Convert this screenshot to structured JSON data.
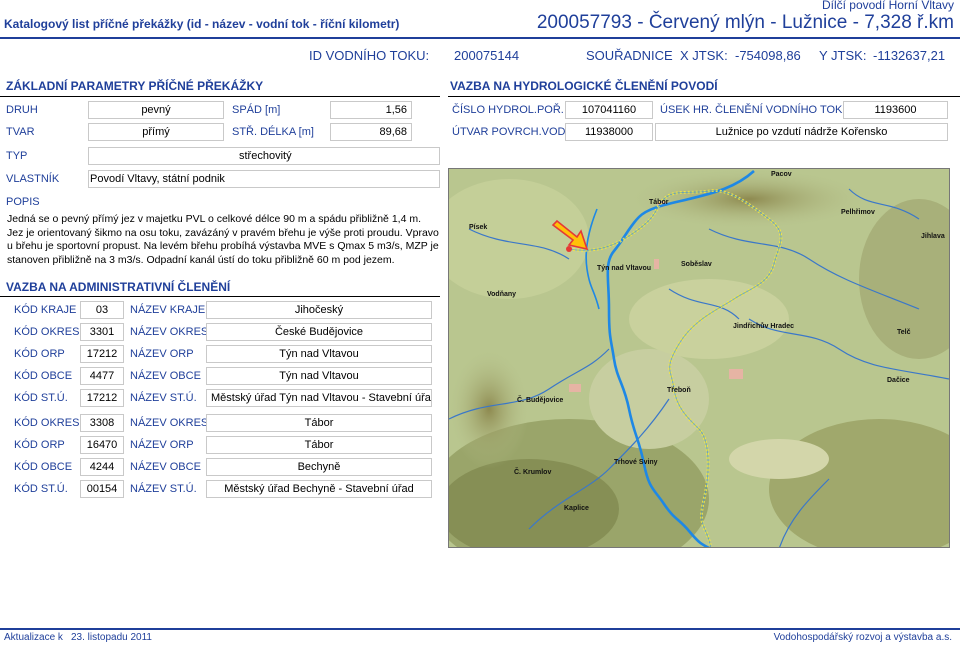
{
  "header": {
    "left_title": "Katalogový list příčné překážky (id - název - vodní tok - říční kilometr)",
    "region": "Dílčí povodí Horní Vltavy",
    "object_title": "200057793 - Červený mlýn - Lužnice - 7,328 ř.km",
    "id_label": "ID VODNÍHO TOKU:",
    "id_value": "200075144",
    "coords_label": "SOUŘADNICE",
    "x_label": "X JTSK:",
    "x_value": "-754098,86",
    "y_label": "Y JTSK:",
    "y_value": "-1132637,21"
  },
  "basic": {
    "title": "ZÁKLADNÍ PARAMETRY PŘÍČNÉ PŘEKÁŽKY",
    "druh_label": "DRUH",
    "druh_value": "pevný",
    "spad_label": "SPÁD [m]",
    "spad_value": "1,56",
    "tvar_label": "TVAR",
    "tvar_value": "přímý",
    "delka_label": "STŘ. DÉLKA [m]",
    "delka_value": "89,68",
    "typ_label": "TYP",
    "typ_value": "střechovitý",
    "vlastnik_label": "VLASTNÍK",
    "vlastnik_value": "Povodí Vltavy, státní podnik",
    "popis_label": "POPIS",
    "popis_text": "Jedná se o pevný přímý jez v majetku PVL o celkové délce 90 m a spádu přibližně 1,4 m. Jez je orientovaný šikmo na osu toku, zavázáný v pravém břehu je výše proti proudu. Vpravo u břehu je sportovní propust. Na levém břehu probíhá výstavba MVE s Qmax 5 m3/s, MZP je stanoven přibližně na 3 m3/s. Odpadní kanál ústí do toku přibližně 60 m pod jezem."
  },
  "hydro": {
    "title": "VAZBA NA HYDROLOGICKÉ ČLENĚNÍ POVODÍ",
    "cislo_label": "ČÍSLO HYDROL.POŘ.",
    "cislo_value": "107041160",
    "usek_label": "ÚSEK HR. ČLENĚNÍ VODNÍHO TOKU",
    "usek_value": "1193600",
    "utvar_label": "ÚTVAR POVRCH.VOD",
    "utvar_value": "11938000",
    "utvar_name": "Lužnice po vzdutí nádrže Kořensko"
  },
  "admin": {
    "title": "VAZBA NA ADMINISTRATIVNÍ ČLENĚNÍ",
    "rows": [
      {
        "code_label": "KÓD KRAJE",
        "code": "03",
        "name_label": "NÁZEV KRAJE",
        "name": "Jihočeský"
      },
      {
        "code_label": "KÓD OKRESU",
        "code": "3301",
        "name_label": "NÁZEV OKRESU",
        "name": "České Budějovice"
      },
      {
        "code_label": "KÓD ORP",
        "code": "17212",
        "name_label": "NÁZEV ORP",
        "name": "Týn nad Vltavou"
      },
      {
        "code_label": "KÓD OBCE",
        "code": "4477",
        "name_label": "NÁZEV OBCE",
        "name": "Týn nad Vltavou"
      },
      {
        "code_label": "KÓD ST.Ú.",
        "code": "17212",
        "name_label": "NÁZEV ST.Ú.",
        "name": "Městský úřad Týn nad Vltavou - Stavební úřad"
      },
      {
        "code_label": "KÓD OKRESU",
        "code": "3308",
        "name_label": "NÁZEV OKRESU",
        "name": "Tábor"
      },
      {
        "code_label": "KÓD ORP",
        "code": "16470",
        "name_label": "NÁZEV ORP",
        "name": "Tábor"
      },
      {
        "code_label": "KÓD OBCE",
        "code": "4244",
        "name_label": "NÁZEV OBCE",
        "name": "Bechyně"
      },
      {
        "code_label": "KÓD ST.Ú.",
        "code": "00154",
        "name_label": "NÁZEV ST.Ú.",
        "name": "Městský úřad Bechyně - Stavební úřad"
      }
    ]
  },
  "map": {
    "towns": [
      "Pacov",
      "Tábor",
      "Pelhřimov",
      "Písek",
      "Jihlava",
      "Týn nad Vltavou",
      "Soběslav",
      "Vodňany",
      "Jindřichův Hradec",
      "Telč",
      "Dačice",
      "Č. Budějovice",
      "Třeboň",
      "Trhové Sviny",
      "Č. Krumlov",
      "Kaplice"
    ],
    "colors": {
      "river": "#1e88e5",
      "route": "#ffeb3b",
      "marker": "#e53935"
    }
  },
  "footer": {
    "update_label": "Aktualizace k",
    "update_date": "23. listopadu 2011",
    "org": "Vodohospodářský rozvoj a výstavba a.s."
  }
}
